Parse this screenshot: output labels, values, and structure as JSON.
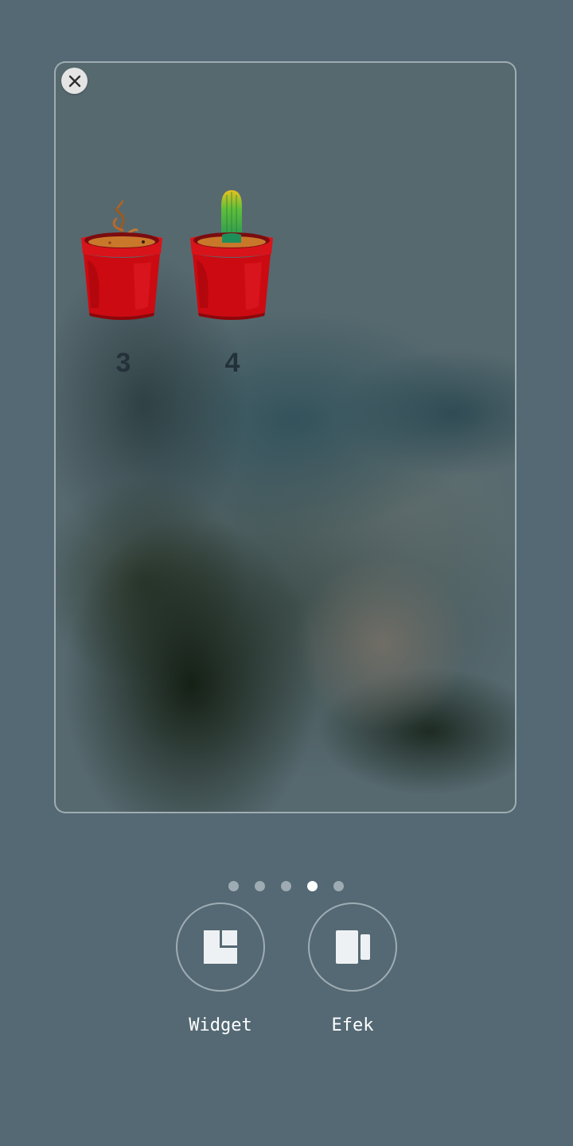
{
  "home_screen": {
    "page_preview": {
      "close_icon": "close-icon",
      "apps": [
        {
          "label": "3",
          "icon": "sprout-pot-icon"
        },
        {
          "label": "4",
          "icon": "cactus-pot-icon"
        }
      ]
    },
    "page_indicator": {
      "total_pages": 5,
      "active_page": 4
    },
    "actions": [
      {
        "label": "Widget",
        "icon": "widget-icon"
      },
      {
        "label": "Efek",
        "icon": "effects-icon"
      }
    ]
  }
}
